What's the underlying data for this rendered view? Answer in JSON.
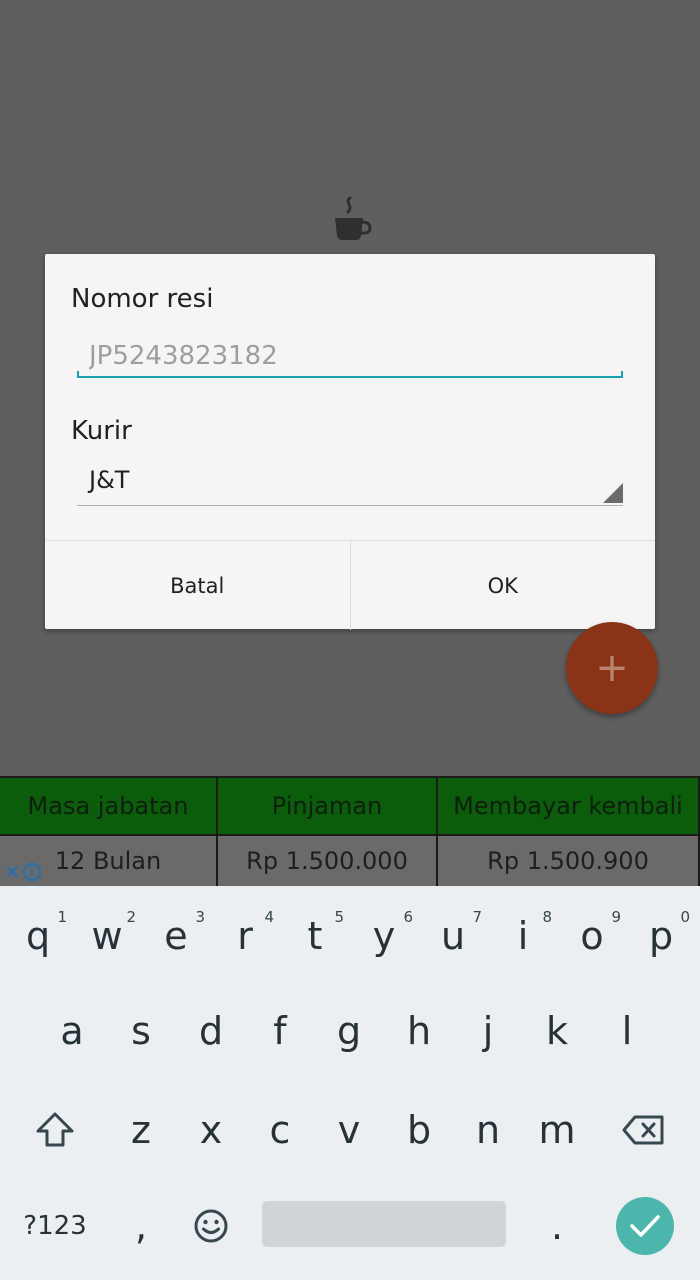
{
  "dialog": {
    "resi_label": "Nomor resi",
    "resi_placeholder": "JP5243823182",
    "kurir_label": "Kurir",
    "kurir_value": "J&T",
    "cancel_label": "Batal",
    "ok_label": "OK"
  },
  "fab": {
    "icon": "plus-icon",
    "symbol": "+"
  },
  "table": {
    "headers": [
      "Masa jabatan",
      "Pinjaman",
      "Membayar kembali"
    ],
    "row": [
      "12 Bulan",
      "Rp 1.500.000",
      "Rp 1.500.900"
    ]
  },
  "keyboard": {
    "row1": [
      {
        "key": "q",
        "hint": "1"
      },
      {
        "key": "w",
        "hint": "2"
      },
      {
        "key": "e",
        "hint": "3"
      },
      {
        "key": "r",
        "hint": "4"
      },
      {
        "key": "t",
        "hint": "5"
      },
      {
        "key": "y",
        "hint": "6"
      },
      {
        "key": "u",
        "hint": "7"
      },
      {
        "key": "i",
        "hint": "8"
      },
      {
        "key": "o",
        "hint": "9"
      },
      {
        "key": "p",
        "hint": "0"
      }
    ],
    "row2": [
      "a",
      "s",
      "d",
      "f",
      "g",
      "h",
      "j",
      "k",
      "l"
    ],
    "row3": [
      "z",
      "x",
      "c",
      "v",
      "b",
      "n",
      "m"
    ],
    "symbols_label": "?123",
    "comma": ",",
    "period": "."
  },
  "colors": {
    "accent": "#1a9fb0",
    "fab": "#8a3316",
    "table_header": "#0b5c0b",
    "enter": "#4db6ac"
  }
}
